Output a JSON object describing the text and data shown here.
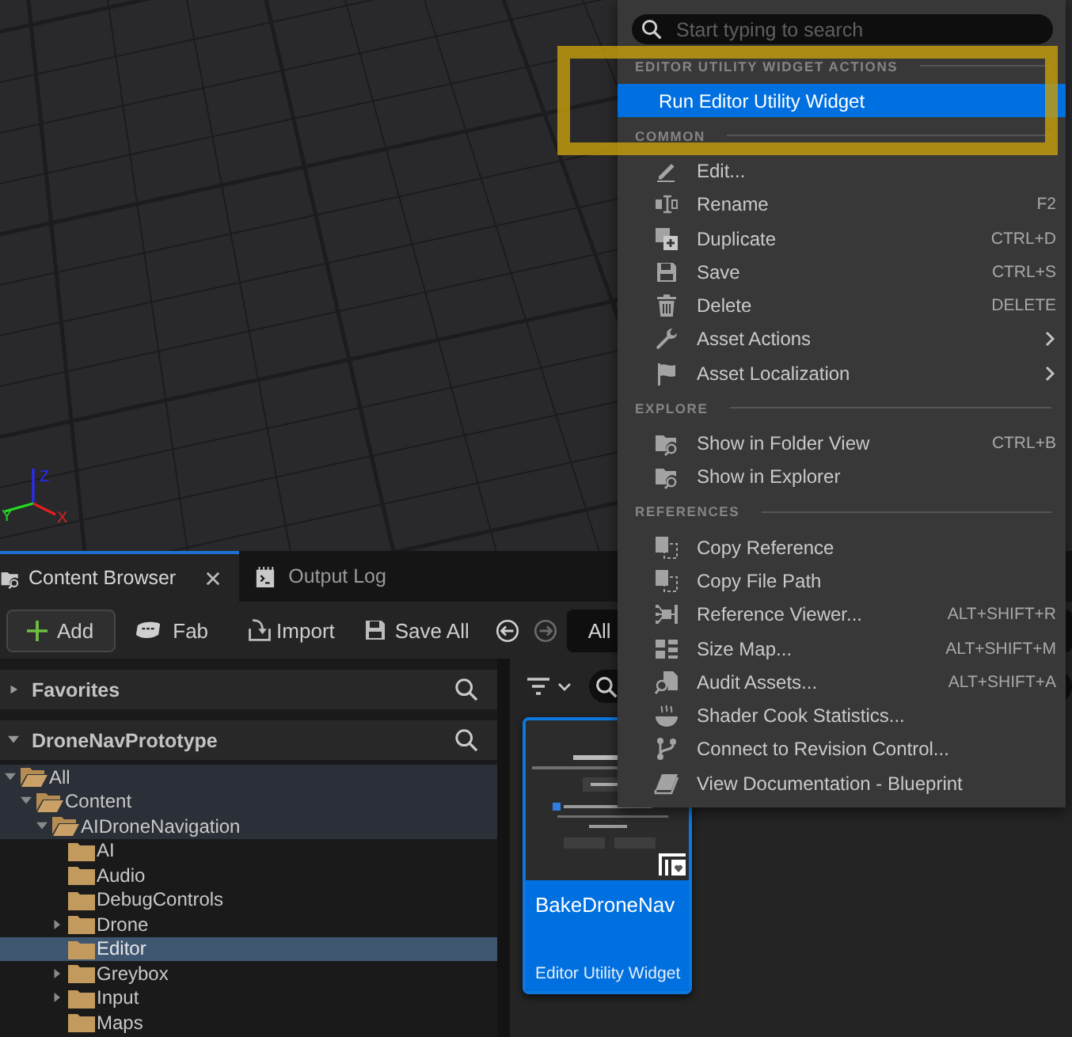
{
  "viewport": {
    "axes": [
      {
        "label": "Z",
        "color": "#2a2aff"
      },
      {
        "label": "Y",
        "color": "#22dd22"
      },
      {
        "label": "X",
        "color": "#e02020"
      }
    ]
  },
  "annotations": [
    {
      "kind": "frame"
    }
  ],
  "content_browser": {
    "tabs": [
      {
        "label": "Content Browser",
        "selected": true
      },
      {
        "label": "Output Log",
        "selected": false
      }
    ],
    "toolbar": [
      {
        "label": "Add",
        "kind": "add"
      },
      {
        "label": "Fab",
        "kind": "fab"
      },
      {
        "label": "Import",
        "kind": "import"
      },
      {
        "label": "Save All",
        "kind": "save"
      }
    ],
    "history": [
      {
        "kind": "back",
        "disabled": false
      },
      {
        "kind": "forward",
        "disabled": true
      }
    ],
    "path": "All",
    "sources": [
      {
        "title": "Favorites",
        "expanded": false
      },
      {
        "title": "DroneNavPrototype",
        "expanded": true,
        "tree": [
          {
            "label": "All",
            "expanded": true,
            "highlighted": true,
            "selected": false,
            "children": [
              {
                "label": "Content",
                "expanded": true,
                "highlighted": true,
                "selected": false,
                "children": [
                  {
                    "label": "AIDroneNavigation",
                    "expanded": true,
                    "highlighted": true,
                    "selected": false,
                    "children": [
                      {
                        "label": "AI",
                        "highlighted": false,
                        "selected": false
                      },
                      {
                        "label": "Audio",
                        "highlighted": false,
                        "selected": false
                      },
                      {
                        "label": "DebugControls",
                        "highlighted": false,
                        "selected": false
                      },
                      {
                        "label": "Drone",
                        "expanded": false,
                        "highlighted": false,
                        "selected": false
                      },
                      {
                        "label": "Editor",
                        "highlighted": false,
                        "selected": true
                      },
                      {
                        "label": "Greybox",
                        "expanded": false,
                        "highlighted": false,
                        "selected": false
                      },
                      {
                        "label": "Input",
                        "expanded": false,
                        "highlighted": false,
                        "selected": false
                      },
                      {
                        "label": "Maps",
                        "highlighted": false,
                        "selected": false
                      }
                    ]
                  }
                ]
              }
            ]
          }
        ]
      }
    ],
    "assets": [
      {
        "name": "BakeDroneNav",
        "type": "Editor Utility Widget",
        "selected": true
      }
    ]
  },
  "context_menu": {
    "search": {
      "placeholder": "Start typing to search"
    },
    "sections": [
      {
        "title": "EDITOR UTILITY WIDGET ACTIONS",
        "items": [
          {
            "label": "Run Editor Utility Widget",
            "selected": true
          }
        ]
      },
      {
        "title": "COMMON",
        "items": [
          {
            "label": "Edit...",
            "selected": false
          },
          {
            "label": "Rename",
            "shortcut": "F2",
            "selected": false
          },
          {
            "label": "Duplicate",
            "shortcut": "CTRL+D",
            "selected": false
          },
          {
            "label": "Save",
            "shortcut": "CTRL+S",
            "selected": false
          },
          {
            "label": "Delete",
            "shortcut": "DELETE",
            "selected": false
          },
          {
            "label": "Asset Actions",
            "submenu": true,
            "selected": false
          },
          {
            "label": "Asset Localization",
            "submenu": true,
            "selected": false
          }
        ]
      },
      {
        "title": "EXPLORE",
        "items": [
          {
            "label": "Show in Folder View",
            "shortcut": "CTRL+B",
            "selected": false
          },
          {
            "label": "Show in Explorer",
            "selected": false
          }
        ]
      },
      {
        "title": "REFERENCES",
        "items": [
          {
            "label": "Copy Reference",
            "selected": false
          },
          {
            "label": "Copy File Path",
            "selected": false
          },
          {
            "label": "Reference Viewer...",
            "shortcut": "ALT+SHIFT+R",
            "selected": false
          },
          {
            "label": "Size Map...",
            "shortcut": "ALT+SHIFT+M",
            "selected": false
          },
          {
            "label": "Audit Assets...",
            "shortcut": "ALT+SHIFT+A",
            "selected": false
          },
          {
            "label": "Shader Cook Statistics...",
            "selected": false
          },
          {
            "label": "Connect to Revision Control...",
            "selected": false
          },
          {
            "label": "View Documentation - Blueprint",
            "selected": false
          }
        ]
      }
    ]
  }
}
